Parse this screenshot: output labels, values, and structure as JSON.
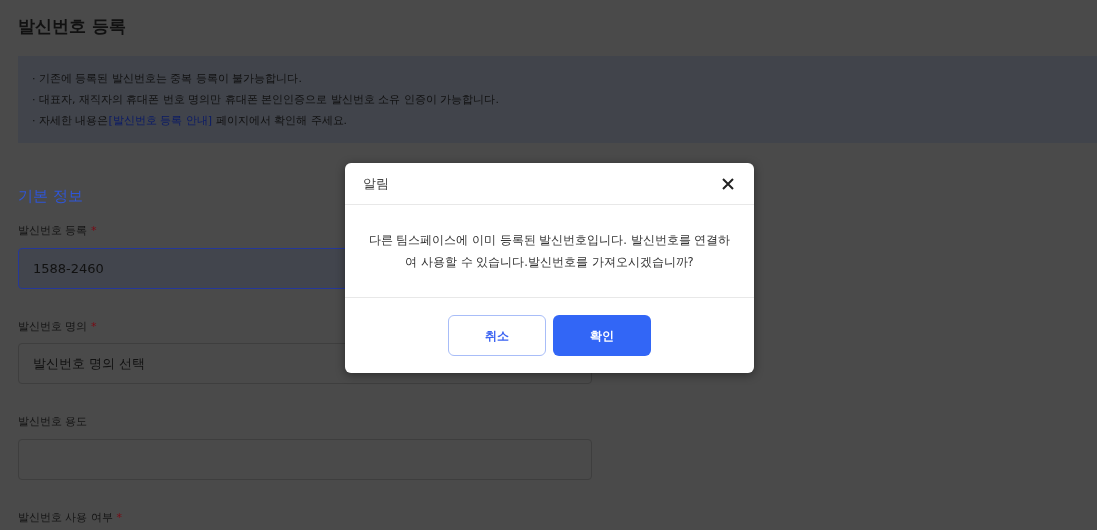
{
  "page": {
    "title": "발신번호 등록"
  },
  "notices": [
    {
      "bullet": "·",
      "text": "기존에 등록된 발신번호는 중복 등록이 불가능합니다."
    },
    {
      "bullet": "·",
      "text": "대표자, 재직자의 휴대폰 번호 명의만 휴대폰 본인인증으로 발신번호 소유 인증이 가능합니다."
    },
    {
      "bullet": "·",
      "text": "자세한 내용은",
      "link": "[발신번호 등록 안내]",
      "after": " 페이지에서 확인해 주세요."
    }
  ],
  "section_title": "기본 정보",
  "fields": [
    {
      "kind": "input",
      "label": "발신번호 등록",
      "required_mark": "*",
      "value": "1588-2460",
      "focused": true
    },
    {
      "kind": "select",
      "label": "발신번호 명의",
      "required_mark": "*",
      "value": "발신번호 명의 선택",
      "focused": false
    },
    {
      "kind": "input",
      "label": "발신번호 용도",
      "focused": false
    },
    {
      "kind": "label",
      "label": "발신번호 사용 여부",
      "required_mark": "*"
    }
  ],
  "dialog": {
    "title": "알림",
    "message": "다른 팀스페이스에 이미 등록된 발신번호입니다. 발신번호를 연결하여 사용할 수 있습니다.발신번호를 가져오시겠습니까?",
    "buttons": [
      {
        "label": "취소",
        "kind": "secondary"
      },
      {
        "label": "확인",
        "kind": "primary"
      }
    ]
  }
}
